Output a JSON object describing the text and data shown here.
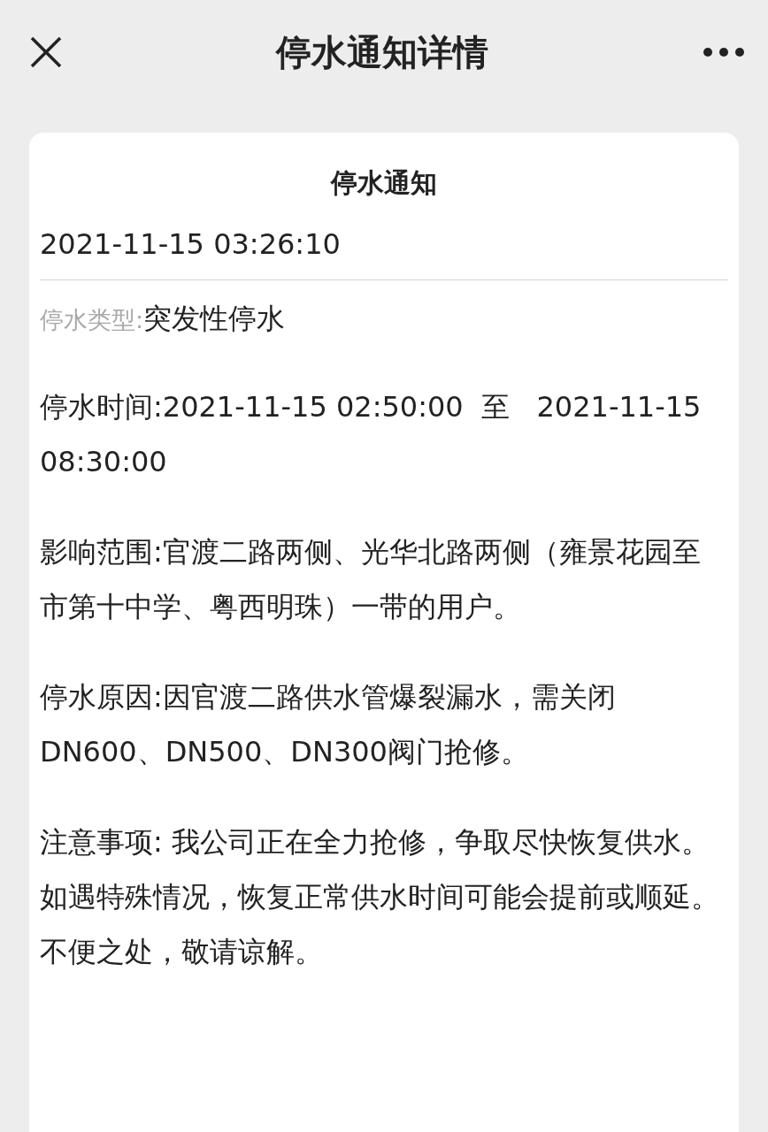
{
  "header": {
    "title": "停水通知详情"
  },
  "notice": {
    "title": "停水通知",
    "published": "2021-11-15 03:26:10",
    "fields": [
      {
        "kind": "labeled",
        "label": "停水类型:",
        "value": "突发性停水"
      },
      {
        "kind": "paragraph",
        "text": "停水时间:2021-11-15 02:50:00  至   2021-11-15 08:30:00"
      },
      {
        "kind": "paragraph",
        "text": "影响范围:官渡二路两侧、光华北路两侧（雍景花园至市第十中学、粤西明珠）一带的用户。"
      },
      {
        "kind": "paragraph",
        "text": "停水原因:因官渡二路供水管爆裂漏水，需关闭DN600、DN500、DN300阀门抢修。"
      },
      {
        "kind": "paragraph",
        "text": "注意事项: 我公司正在全力抢修，争取尽快恢复供水。如遇特殊情况，恢复正常供水时间可能会提前或顺延。不便之处，敬请谅解。"
      }
    ]
  }
}
